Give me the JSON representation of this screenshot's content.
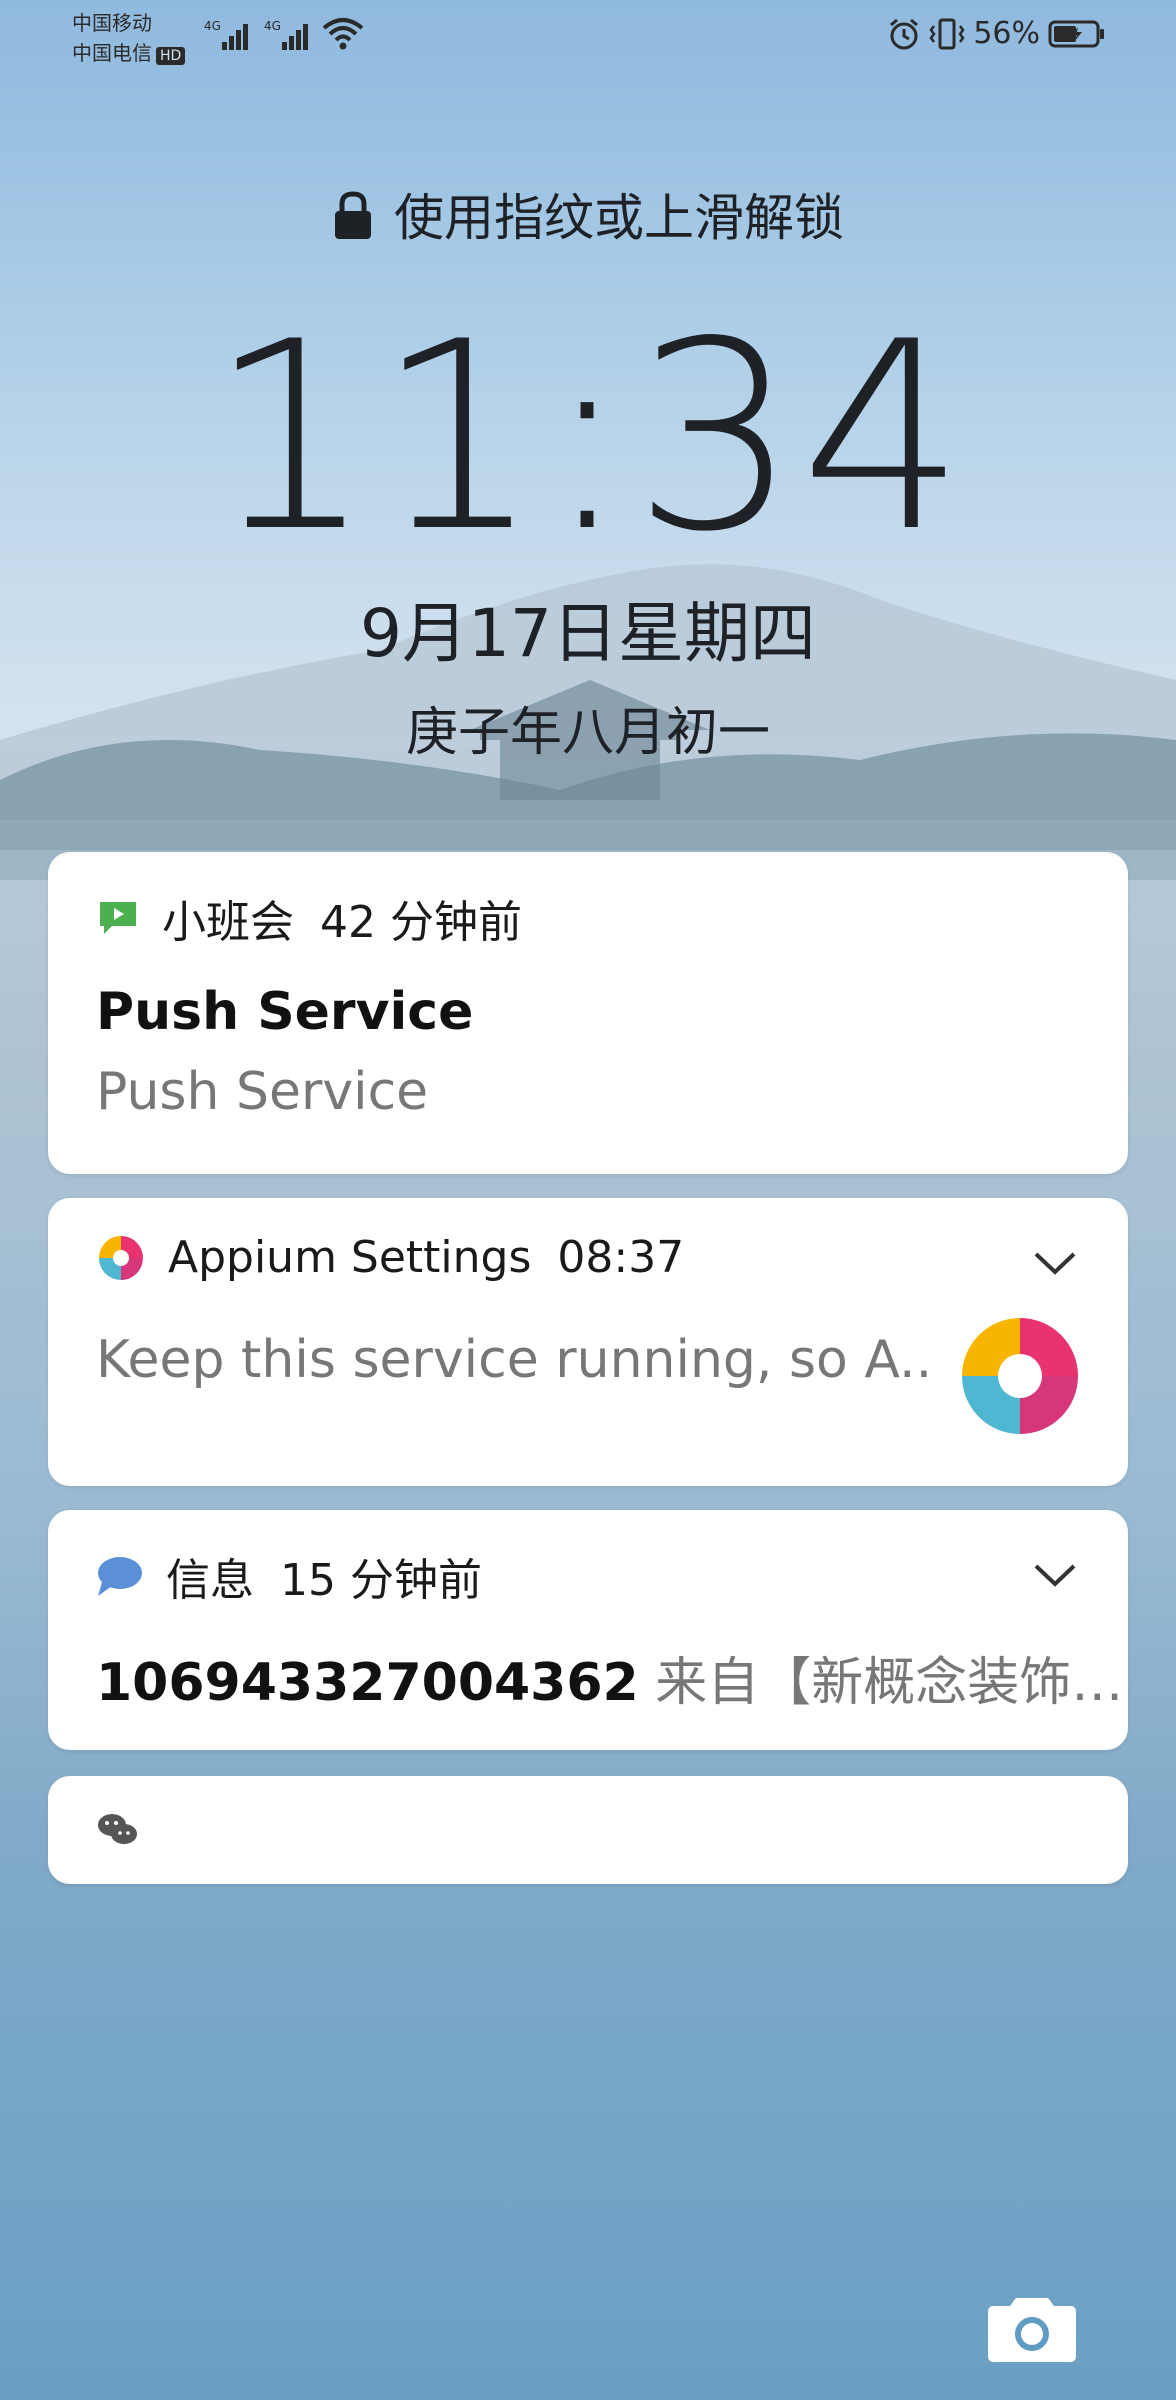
{
  "status_bar": {
    "carrier1": "中国移动",
    "carrier2": "中国电信",
    "hd_label": "HD",
    "net1": "4G",
    "net2": "4G",
    "battery_percent": "56%"
  },
  "lock": {
    "hint": "使用指纹或上滑解锁",
    "time": "11:34",
    "date": "9月17日星期四",
    "lunar_date": "庚子年八月初一"
  },
  "notifications": [
    {
      "app": "小班会",
      "time": "42 分钟前",
      "title": "Push Service",
      "body": "Push Service",
      "icon": "video-chat-icon",
      "color": "#4caf50"
    },
    {
      "app": "Appium Settings",
      "time": "08:37",
      "body": "Keep this service running, so A..",
      "icon": "appium-icon"
    },
    {
      "app": "信息",
      "time": "15 分钟前",
      "sender": "106943327004362",
      "body": "来自【新概念装饰…",
      "icon": "message-bubble-icon",
      "color": "#5b8fd6"
    },
    {
      "icon": "wechat-icon"
    }
  ]
}
